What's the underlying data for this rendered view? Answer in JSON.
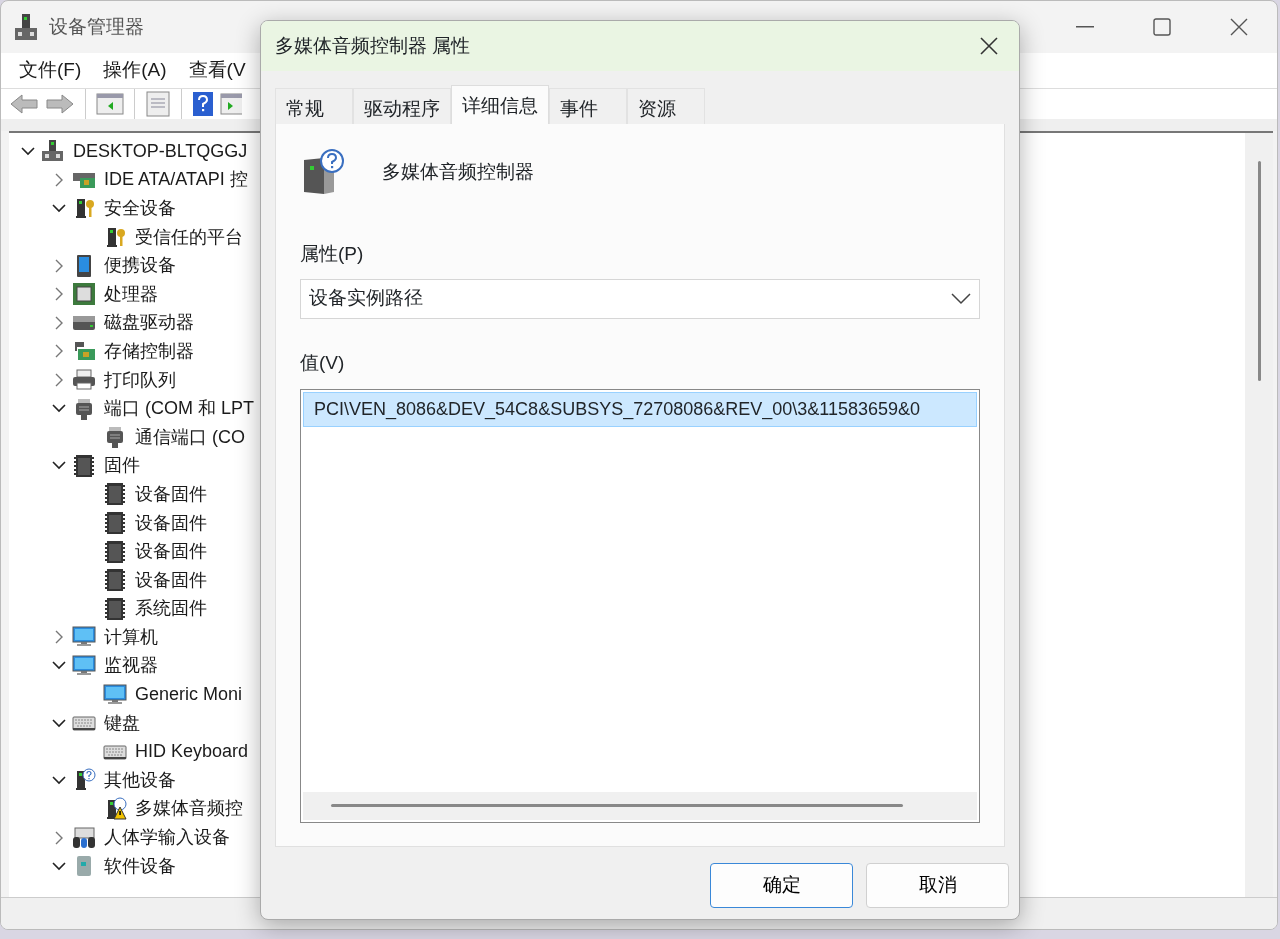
{
  "window": {
    "title": "设备管理器"
  },
  "menu": [
    "文件(F)",
    "操作(A)",
    "查看(V"
  ],
  "tree": [
    {
      "label": "DESKTOP-BLTQGGJ",
      "kind": "computer",
      "expanded": true,
      "children": [
        {
          "label": "IDE ATA/ATAPI 控",
          "kind": "card",
          "expanded": false
        },
        {
          "label": "安全设备",
          "kind": "security",
          "expanded": true,
          "children": [
            {
              "label": "受信任的平台",
              "kind": "security"
            }
          ]
        },
        {
          "label": "便携设备",
          "kind": "portable",
          "expanded": false
        },
        {
          "label": "处理器",
          "kind": "cpu",
          "expanded": false
        },
        {
          "label": "磁盘驱动器",
          "kind": "disk",
          "expanded": false
        },
        {
          "label": "存储控制器",
          "kind": "storage",
          "expanded": false
        },
        {
          "label": "打印队列",
          "kind": "printer",
          "expanded": false
        },
        {
          "label": "端口 (COM 和 LPT",
          "kind": "port",
          "expanded": true,
          "children": [
            {
              "label": "通信端口 (CO",
              "kind": "port"
            }
          ]
        },
        {
          "label": "固件",
          "kind": "chip",
          "expanded": true,
          "children": [
            {
              "label": "设备固件",
              "kind": "chip"
            },
            {
              "label": "设备固件",
              "kind": "chip"
            },
            {
              "label": "设备固件",
              "kind": "chip"
            },
            {
              "label": "设备固件",
              "kind": "chip"
            },
            {
              "label": "系统固件",
              "kind": "chip"
            }
          ]
        },
        {
          "label": "计算机",
          "kind": "monitor",
          "expanded": false
        },
        {
          "label": "监视器",
          "kind": "monitor",
          "expanded": true,
          "children": [
            {
              "label": "Generic Moni",
              "kind": "monitor"
            }
          ]
        },
        {
          "label": "键盘",
          "kind": "keyboard",
          "expanded": true,
          "children": [
            {
              "label": "HID Keyboard",
              "kind": "keyboard"
            }
          ]
        },
        {
          "label": "其他设备",
          "kind": "unknown",
          "expanded": true,
          "children": [
            {
              "label": "多媒体音频控",
              "kind": "warning"
            }
          ]
        },
        {
          "label": "人体学输入设备",
          "kind": "hid",
          "expanded": false
        },
        {
          "label": "软件设备",
          "kind": "software",
          "expanded": true
        }
      ]
    }
  ],
  "dialog": {
    "title": "多媒体音频控制器 属性",
    "tabs": [
      {
        "label": "常规",
        "selected": false
      },
      {
        "label": "驱动程序",
        "selected": false
      },
      {
        "label": "详细信息",
        "selected": true
      },
      {
        "label": "事件",
        "selected": false
      },
      {
        "label": "资源",
        "selected": false
      }
    ],
    "device_name": "多媒体音频控制器",
    "property_label": "属性(P)",
    "property_value": "设备实例路径",
    "value_label": "值(V)",
    "values": [
      {
        "text": "PCI\\VEN_8086&DEV_54C8&SUBSYS_72708086&REV_00\\3&11583659&0",
        "selected": true
      }
    ],
    "buttons": [
      {
        "label": "确定",
        "default": true
      },
      {
        "label": "取消",
        "default": false
      }
    ]
  }
}
